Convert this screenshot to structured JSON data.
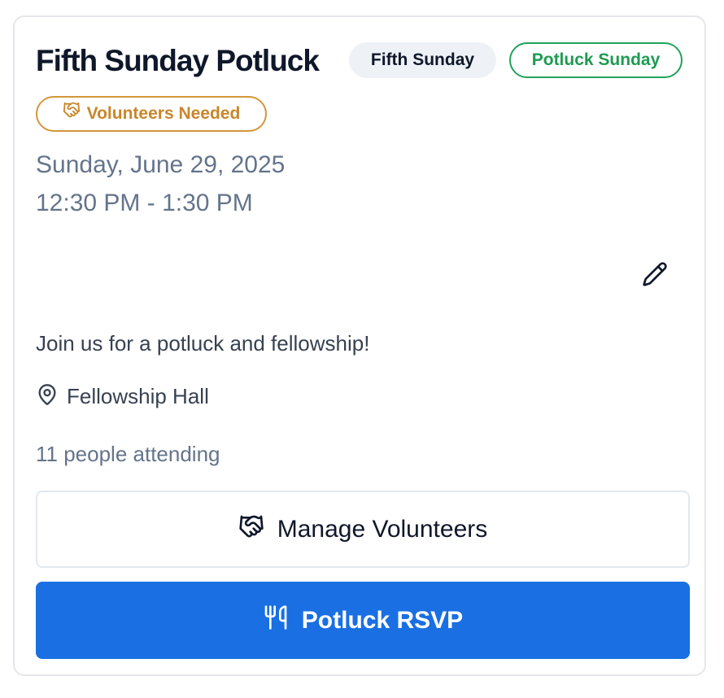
{
  "event": {
    "title": "Fifth Sunday Potluck",
    "badges": {
      "fifth_sunday": "Fifth Sunday",
      "potluck_sunday": "Potluck Sunday",
      "volunteers_needed": "Volunteers Needed"
    },
    "date": "Sunday, June 29, 2025",
    "time": "12:30 PM - 1:30 PM",
    "description": "Join us for a potluck and fellowship!",
    "location": "Fellowship Hall",
    "attendance": "11 people attending"
  },
  "actions": {
    "manage_volunteers": "Manage Volunteers",
    "potluck_rsvp": "Potluck RSVP"
  },
  "icons": {
    "volunteers_badge": "handshake-icon",
    "edit": "pencil-icon",
    "location": "map-pin-icon",
    "manage_volunteers": "handshake-icon",
    "potluck_rsvp": "utensils-icon"
  },
  "colors": {
    "primary": "#1a6fe3",
    "success": "#1f9a52",
    "warning": "#c9862b",
    "muted_text": "#64748b",
    "title_text": "#0f172a"
  }
}
